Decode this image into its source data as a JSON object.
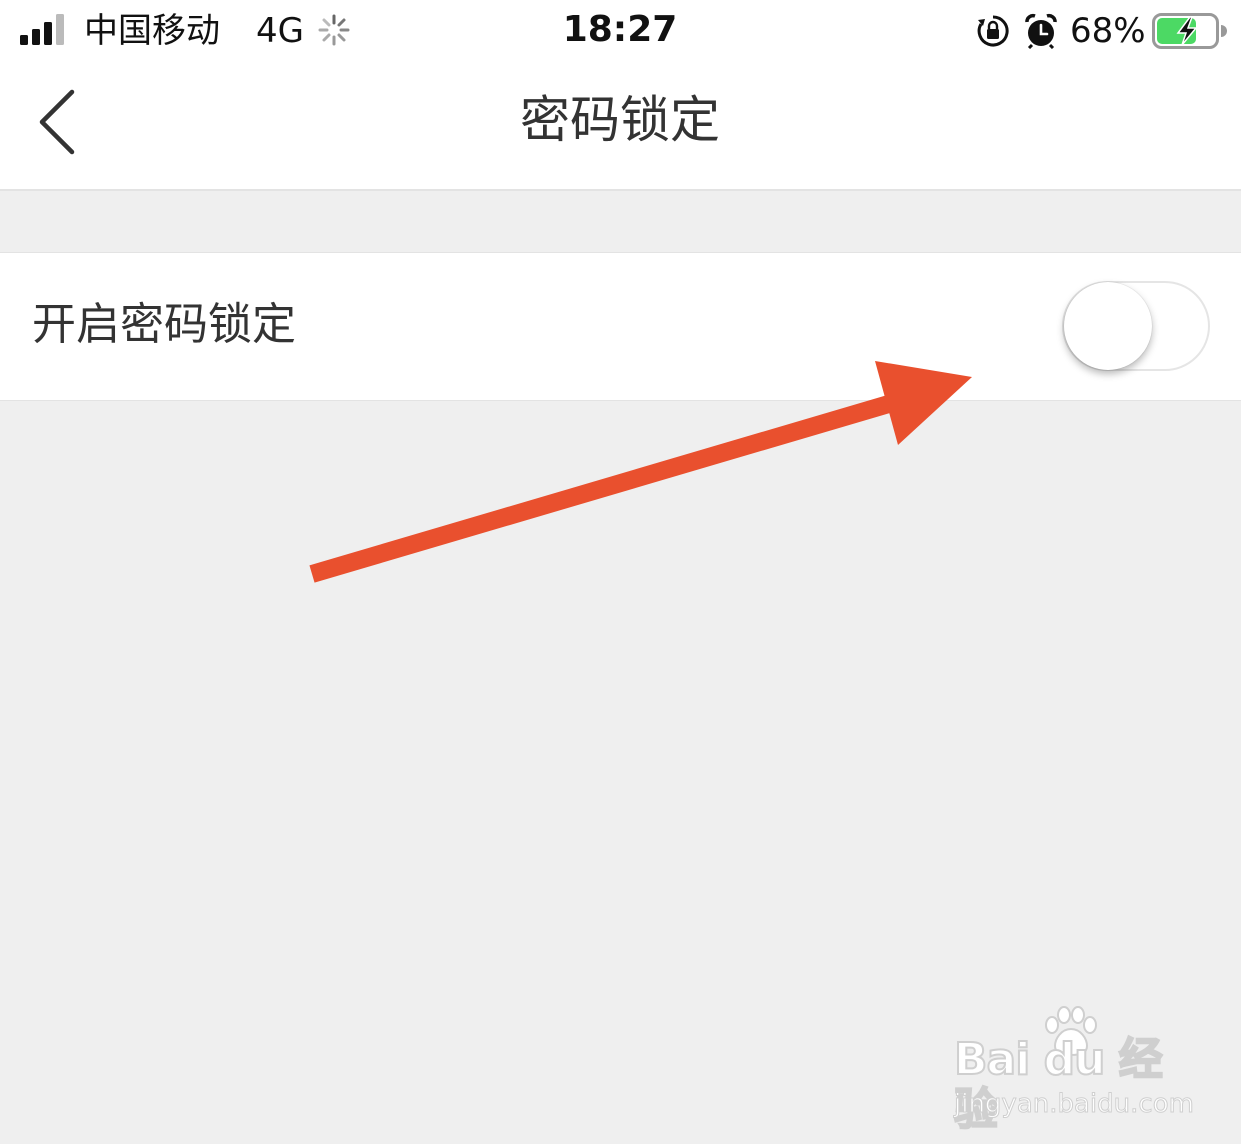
{
  "status_bar": {
    "carrier": "中国移动",
    "network": "4G",
    "time": "18:27",
    "battery_percent": "68%",
    "battery_level": 0.68,
    "icons": [
      "signal-icon",
      "spinner-icon",
      "rotation-lock-icon",
      "alarm-icon",
      "battery-charging-icon"
    ]
  },
  "nav": {
    "title": "密码锁定",
    "back_icon": "chevron-left-icon"
  },
  "settings": {
    "password_lock": {
      "label": "开启密码锁定",
      "enabled": false
    }
  },
  "annotation": {
    "arrow_color": "#E9502E"
  },
  "watermark": {
    "brand": "Bai du 经验",
    "url": "jingyan.baidu.com"
  },
  "colors": {
    "background": "#EFEFEF",
    "surface": "#FFFFFF",
    "battery_fill": "#4CD964",
    "text": "#333333"
  }
}
